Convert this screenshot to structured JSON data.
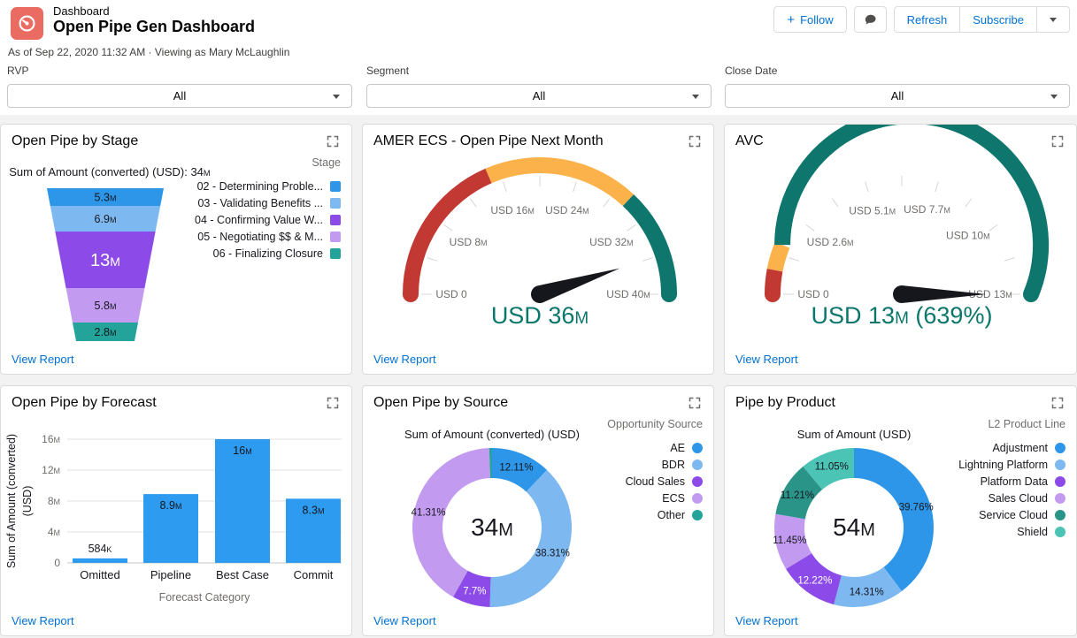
{
  "header": {
    "record_type_label": "Dashboard",
    "title": "Open Pipe Gen Dashboard",
    "meta_line": "As of Sep 22, 2020 11:32 AM · Viewing as Mary McLaughlin",
    "actions": {
      "follow": "Follow",
      "refresh": "Refresh",
      "subscribe": "Subscribe"
    }
  },
  "filters": [
    {
      "label": "RVP",
      "value": "All"
    },
    {
      "label": "Segment",
      "value": "All"
    },
    {
      "label": "Close Date",
      "value": "All"
    }
  ],
  "view_report": "View Report",
  "palette": {
    "link_blue": "#0070D2",
    "brand_icon_red": "#EA6B62",
    "gauge_red": "#C23934",
    "gauge_orange": "#FBB24B",
    "gauge_green": "#0E766C"
  },
  "chart_data": [
    {
      "panel_title": "Open Pipe by Stage",
      "type": "funnel",
      "title": "Sum of Amount (converted) (USD): 34M",
      "legend_title": "Stage",
      "categories": [
        "02 - Determining Proble...",
        "03 - Validating Benefits ...",
        "04 - Confirming Value W...",
        "05 - Negotiating $$ & M...",
        "06 - Finalizing Closure"
      ],
      "values": [
        5.3,
        6.9,
        13,
        5.8,
        2.8
      ],
      "value_labels": [
        "5.3M",
        "6.9M",
        "13M",
        "5.8M",
        "2.8M"
      ],
      "colors": [
        "#2D96E9",
        "#7DB9F0",
        "#8C4BE8",
        "#C29BF1",
        "#23A39A"
      ],
      "segment_heights": [
        20,
        29,
        64,
        39,
        21
      ],
      "unit": "USD (millions)"
    },
    {
      "panel_title": "AMER ECS - Open Pipe Next Month",
      "type": "gauge",
      "min": 0,
      "max": 40,
      "value": 36,
      "value_label": "USD 36M",
      "tick_labels": [
        {
          "f": 0,
          "label": "USD 0"
        },
        {
          "f": 0.2,
          "label": "USD 8M"
        },
        {
          "f": 0.4,
          "label": "USD 16M"
        },
        {
          "f": 0.6,
          "label": "USD 24M"
        },
        {
          "f": 0.8,
          "label": "USD 32M"
        },
        {
          "f": 1,
          "label": "USD 40M"
        }
      ],
      "bands": [
        {
          "to": 0.37,
          "color": "#C23934"
        },
        {
          "to": 0.74,
          "color": "#FBB24B"
        },
        {
          "to": 1,
          "color": "#0E766C"
        }
      ]
    },
    {
      "panel_title": "AVC",
      "type": "gauge",
      "min": 0,
      "max": 13,
      "value": 13,
      "value_label": "USD 13M (639%)",
      "tick_labels": [
        {
          "f": 0,
          "label": "USD 0"
        },
        {
          "f": 0.2,
          "label": "USD 2.6M"
        },
        {
          "f": 0.392,
          "label": "USD 5.1M"
        },
        {
          "f": 0.592,
          "label": "USD 7.7M"
        },
        {
          "f": 0.769,
          "label": "USD 10M"
        },
        {
          "f": 1,
          "label": "USD 13M"
        }
      ],
      "bands": [
        {
          "to": 0.06,
          "color": "#C23934"
        },
        {
          "to": 0.125,
          "color": "#FBB24B"
        },
        {
          "to": 1,
          "color": "#0E766C"
        }
      ]
    },
    {
      "panel_title": "Open Pipe by Forecast",
      "type": "bar",
      "categories": [
        "Omitted",
        "Pipeline",
        "Best Case",
        "Commit"
      ],
      "values": [
        0.584,
        8.9,
        16,
        8.3
      ],
      "value_labels": [
        "584K",
        "8.9M",
        "16M",
        "8.3M"
      ],
      "bar_color": "#2D9BF0",
      "xlabel": "Forecast Category",
      "ylabel_lines": [
        "Sum of Amount (converted)",
        "(USD)"
      ],
      "ylim": [
        0,
        16
      ],
      "yticks": [
        {
          "v": 0,
          "label": "0"
        },
        {
          "v": 4,
          "label": "4M"
        },
        {
          "v": 8,
          "label": "8M"
        },
        {
          "v": 12,
          "label": "12M"
        },
        {
          "v": 16,
          "label": "16M"
        }
      ]
    },
    {
      "panel_title": "Open Pipe by Source",
      "type": "donut",
      "title": "Sum of Amount (converted) (USD)",
      "center_label": "34M",
      "legend_title": "Opportunity Source",
      "slices": [
        {
          "label": "AE",
          "pct": 12.11,
          "pct_label": "12.11%",
          "color": "#2D96E9",
          "text": "dark"
        },
        {
          "label": "BDR",
          "pct": 38.31,
          "pct_label": "38.31%",
          "color": "#7DB9F0",
          "text": "dark"
        },
        {
          "label": "Cloud Sales",
          "pct": 7.7,
          "pct_label": "7.7%",
          "color": "#8C4BE8",
          "text": "light"
        },
        {
          "label": "ECS",
          "pct": 41.31,
          "pct_label": "41.31%",
          "color": "#C29BF1",
          "text": "dark"
        },
        {
          "label": "Other",
          "pct": 0.57,
          "pct_label": "",
          "color": "#23A39A",
          "text": "dark"
        }
      ]
    },
    {
      "panel_title": "Pipe by Product",
      "type": "donut",
      "title": "Sum of Amount (USD)",
      "center_label": "54M",
      "legend_title": "L2 Product Line",
      "slices": [
        {
          "label": "Adjustment",
          "pct": 39.76,
          "pct_label": "39.76%",
          "color": "#2D96E9",
          "text": "dark"
        },
        {
          "label": "Lightning Platform",
          "pct": 14.31,
          "pct_label": "14.31%",
          "color": "#7DB9F0",
          "text": "dark"
        },
        {
          "label": "Platform Data",
          "pct": 12.22,
          "pct_label": "12.22%",
          "color": "#8C4BE8",
          "text": "light"
        },
        {
          "label": "Sales Cloud",
          "pct": 11.45,
          "pct_label": "11.45%",
          "color": "#C29BF1",
          "text": "dark"
        },
        {
          "label": "Service Cloud",
          "pct": 11.21,
          "pct_label": "11.21%",
          "color": "#2B9488",
          "text": "dark"
        },
        {
          "label": "Shield",
          "pct": 11.05,
          "pct_label": "11.05%",
          "color": "#4BC4B6",
          "text": "dark"
        }
      ]
    }
  ]
}
